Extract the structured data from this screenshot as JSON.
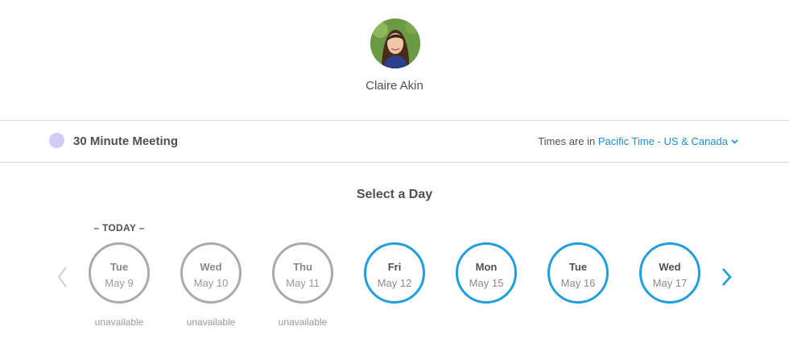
{
  "profile": {
    "name": "Claire Akin"
  },
  "event": {
    "name": "30 Minute Meeting",
    "color": "#cfcdf7"
  },
  "timezone": {
    "prefix": "Times are in",
    "value": "Pacific Time - US & Canada"
  },
  "calendar": {
    "heading": "Select a Day",
    "today_label": "– TODAY –",
    "days": [
      {
        "dow": "Tue",
        "date": "May 9",
        "status": "unavailable",
        "available": false
      },
      {
        "dow": "Wed",
        "date": "May 10",
        "status": "unavailable",
        "available": false
      },
      {
        "dow": "Thu",
        "date": "May 11",
        "status": "unavailable",
        "available": false
      },
      {
        "dow": "Fri",
        "date": "May 12",
        "status": "",
        "available": true
      },
      {
        "dow": "Mon",
        "date": "May 15",
        "status": "",
        "available": true
      },
      {
        "dow": "Tue",
        "date": "May 16",
        "status": "",
        "available": true
      },
      {
        "dow": "Wed",
        "date": "May 17",
        "status": "",
        "available": true
      }
    ]
  },
  "colors": {
    "accent": "#1f9ee0",
    "link": "#1f8dd6",
    "disabled": "#aaaaaa"
  },
  "icons": {
    "prev": "chevron-left-icon",
    "next": "chevron-right-icon",
    "tz": "chevron-down-icon"
  }
}
